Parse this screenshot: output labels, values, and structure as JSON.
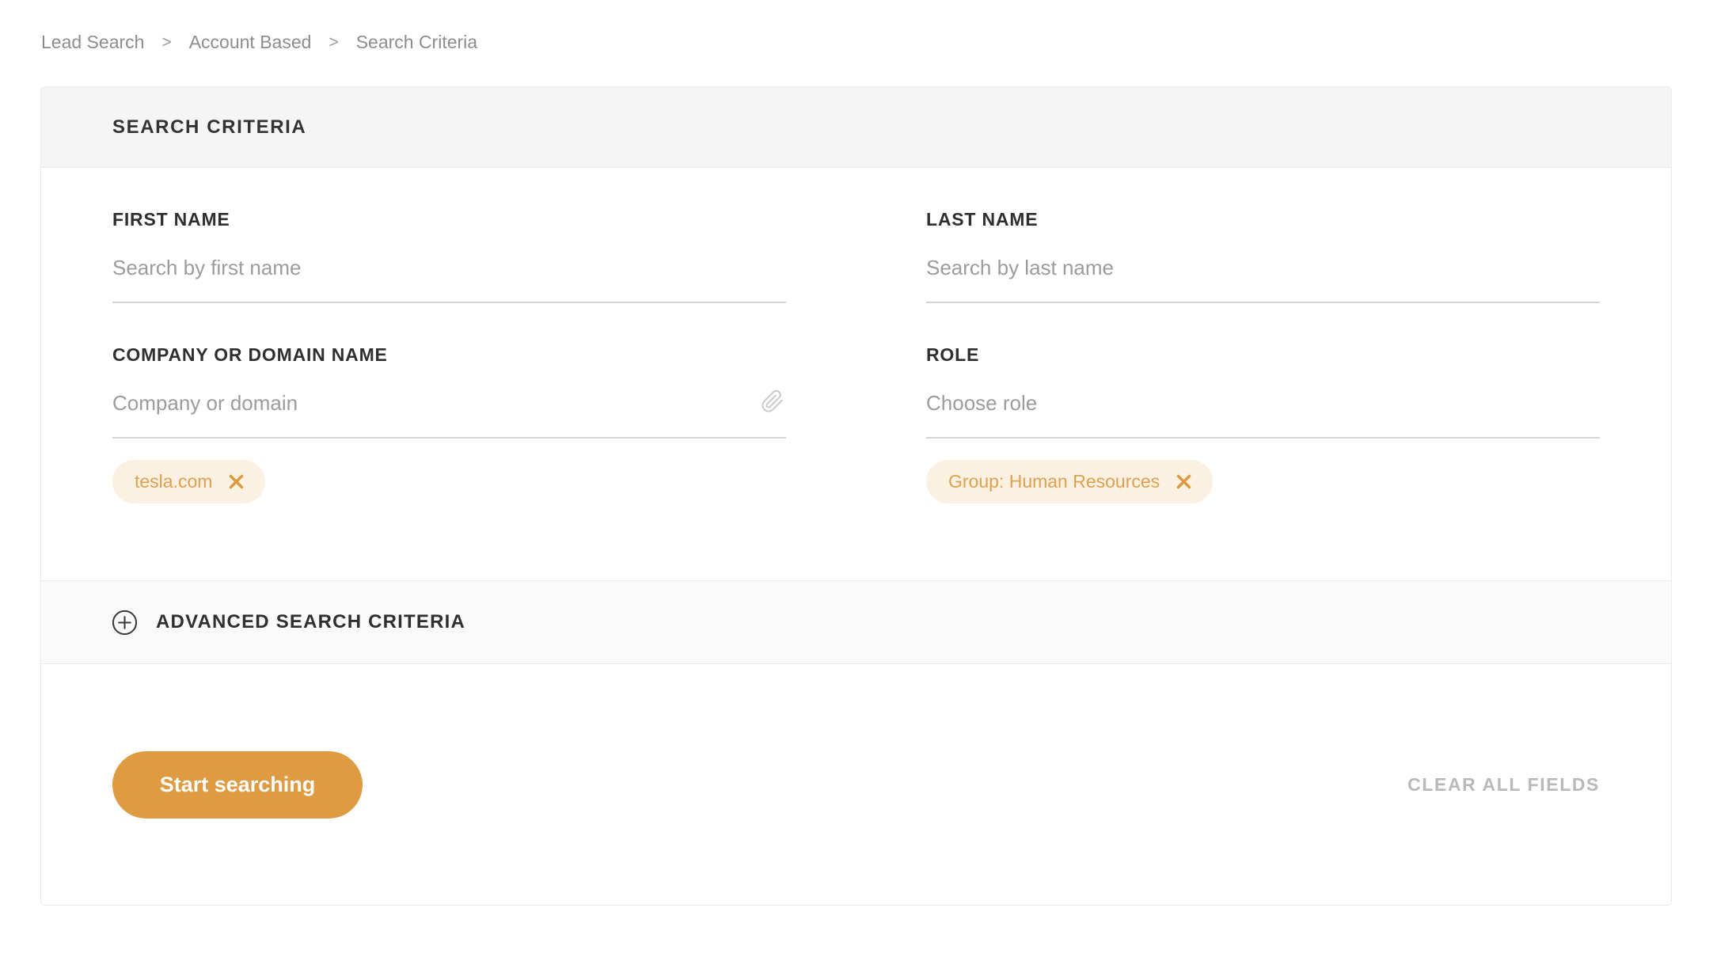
{
  "breadcrumb": {
    "separator": ">",
    "items": [
      {
        "label": "Lead Search"
      },
      {
        "label": "Account Based"
      },
      {
        "label": "Search Criteria"
      }
    ]
  },
  "card": {
    "header_title": "SEARCH CRITERIA",
    "fields": {
      "first_name": {
        "label": "FIRST NAME",
        "placeholder": "Search by first name",
        "value": ""
      },
      "last_name": {
        "label": "LAST NAME",
        "placeholder": "Search by last name",
        "value": ""
      },
      "company": {
        "label": "COMPANY OR DOMAIN NAME",
        "placeholder": "Company or domain",
        "value": "",
        "tags": [
          {
            "label": "tesla.com"
          }
        ]
      },
      "role": {
        "label": "ROLE",
        "placeholder": "Choose role",
        "value": "",
        "tags": [
          {
            "label": "Group: Human Resources"
          }
        ]
      }
    },
    "advanced": {
      "label": "ADVANCED SEARCH CRITERIA"
    },
    "actions": {
      "start_button": "Start searching",
      "clear_all": "CLEAR ALL FIELDS"
    }
  },
  "colors": {
    "accent_orange": "#df9b41",
    "tag_background": "#fbf1e2",
    "tag_text": "#dfa04f",
    "header_strip": "#f5f5f6"
  }
}
